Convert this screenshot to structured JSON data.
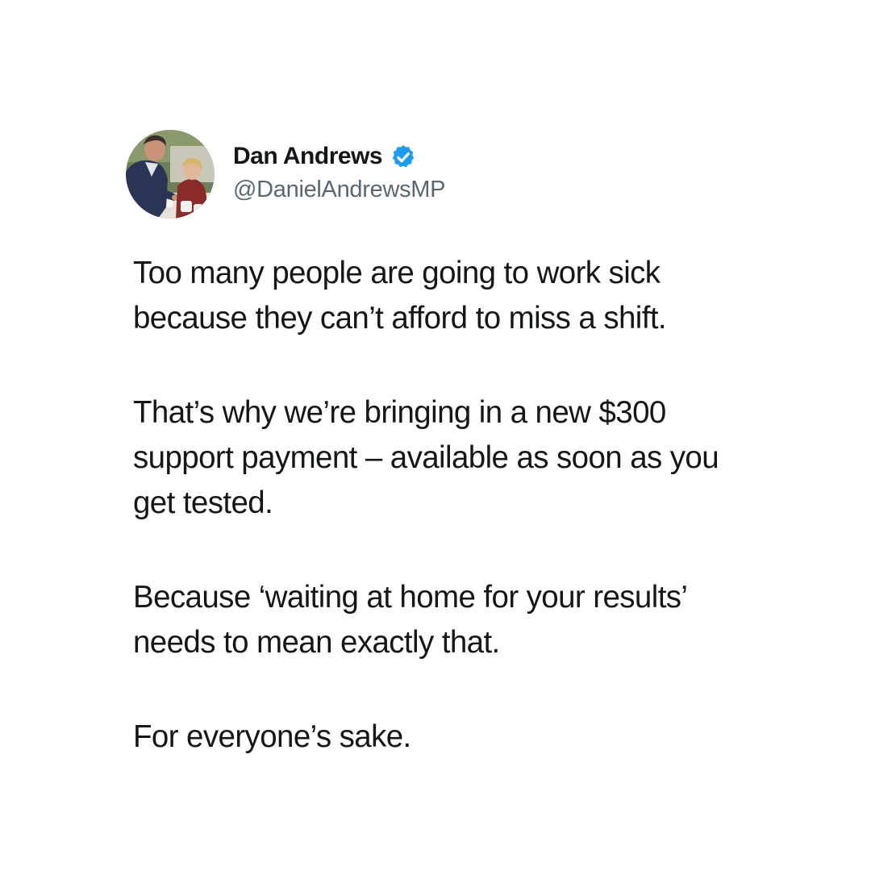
{
  "author": {
    "display_name": "Dan Andrews",
    "handle": "@DanielAndrewsMP",
    "verified": true,
    "avatar_icon": "profile-photo",
    "verified_icon": "verified-badge-icon",
    "verified_color": "#1d9bf0"
  },
  "tweet": {
    "paragraphs": [
      {
        "lines": [
          "Too many people are going to work sick",
          "because they can’t afford to miss a shift."
        ]
      },
      {
        "lines": [
          "That’s why we’re bringing in a new $300",
          "support payment – available as soon as you",
          "get tested."
        ]
      },
      {
        "lines": [
          "Because ‘waiting at home for your results’",
          "needs to mean exactly that."
        ]
      },
      {
        "lines": [
          "For everyone’s sake."
        ]
      }
    ]
  },
  "colors": {
    "background": "#ffffff",
    "text_primary": "#14171a",
    "text_secondary": "#5b6770",
    "verified_blue": "#1d9bf0"
  }
}
